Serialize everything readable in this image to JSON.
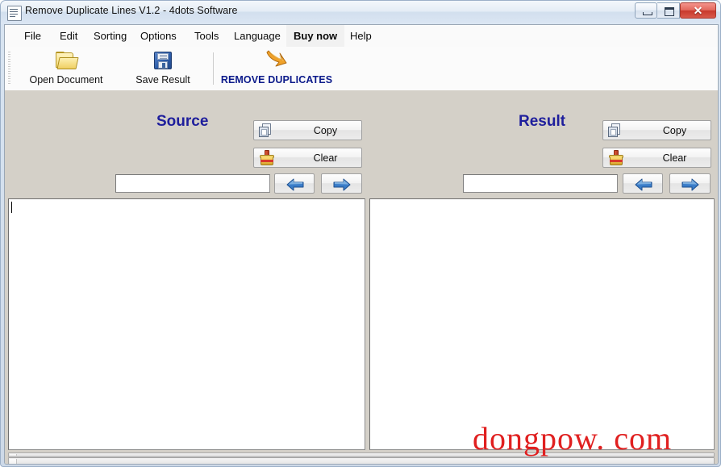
{
  "window": {
    "title": "Remove Duplicate Lines V1.2 - 4dots Software",
    "icon": "document-lines-icon",
    "controls": {
      "minimize": "minimize-icon",
      "maximize": "maximize-icon",
      "close_label": "✕"
    }
  },
  "menu": {
    "items": [
      {
        "label": "File",
        "highlight": false
      },
      {
        "label": "Edit",
        "highlight": false
      },
      {
        "label": "Sorting",
        "highlight": false
      },
      {
        "label": "Options",
        "highlight": false
      },
      {
        "label": "Tools",
        "highlight": false
      },
      {
        "label": "Language",
        "highlight": false
      },
      {
        "label": "Buy now",
        "highlight": true
      },
      {
        "label": "Help",
        "highlight": false
      }
    ]
  },
  "toolbar": {
    "open_document": {
      "label": "Open Document",
      "icon": "folder-icon"
    },
    "save_result": {
      "label": "Save Result",
      "icon": "floppy-disk-icon"
    },
    "remove_duplicates": {
      "label": "REMOVE DUPLICATES",
      "icon": "curved-arrow-icon",
      "color": "#0b1a8a"
    }
  },
  "source": {
    "title": "Source",
    "copy_label": "Copy",
    "clear_label": "Clear",
    "copy_icon": "copy-pages-icon",
    "clear_icon": "paint-bucket-icon",
    "field_value": "",
    "field_placeholder": "",
    "prev_icon": "arrow-left-icon",
    "next_icon": "arrow-right-icon",
    "textarea_value": ""
  },
  "result": {
    "title": "Result",
    "copy_label": "Copy",
    "clear_label": "Clear",
    "copy_icon": "copy-pages-icon",
    "clear_icon": "paint-bucket-icon",
    "field_value": "",
    "field_placeholder": "",
    "prev_icon": "arrow-left-icon",
    "next_icon": "arrow-right-icon",
    "textarea_value": ""
  },
  "statusbar": {
    "progress_text": "",
    "status_text": ""
  },
  "watermark": {
    "text": "dongpow. com",
    "color": "#e02020"
  }
}
